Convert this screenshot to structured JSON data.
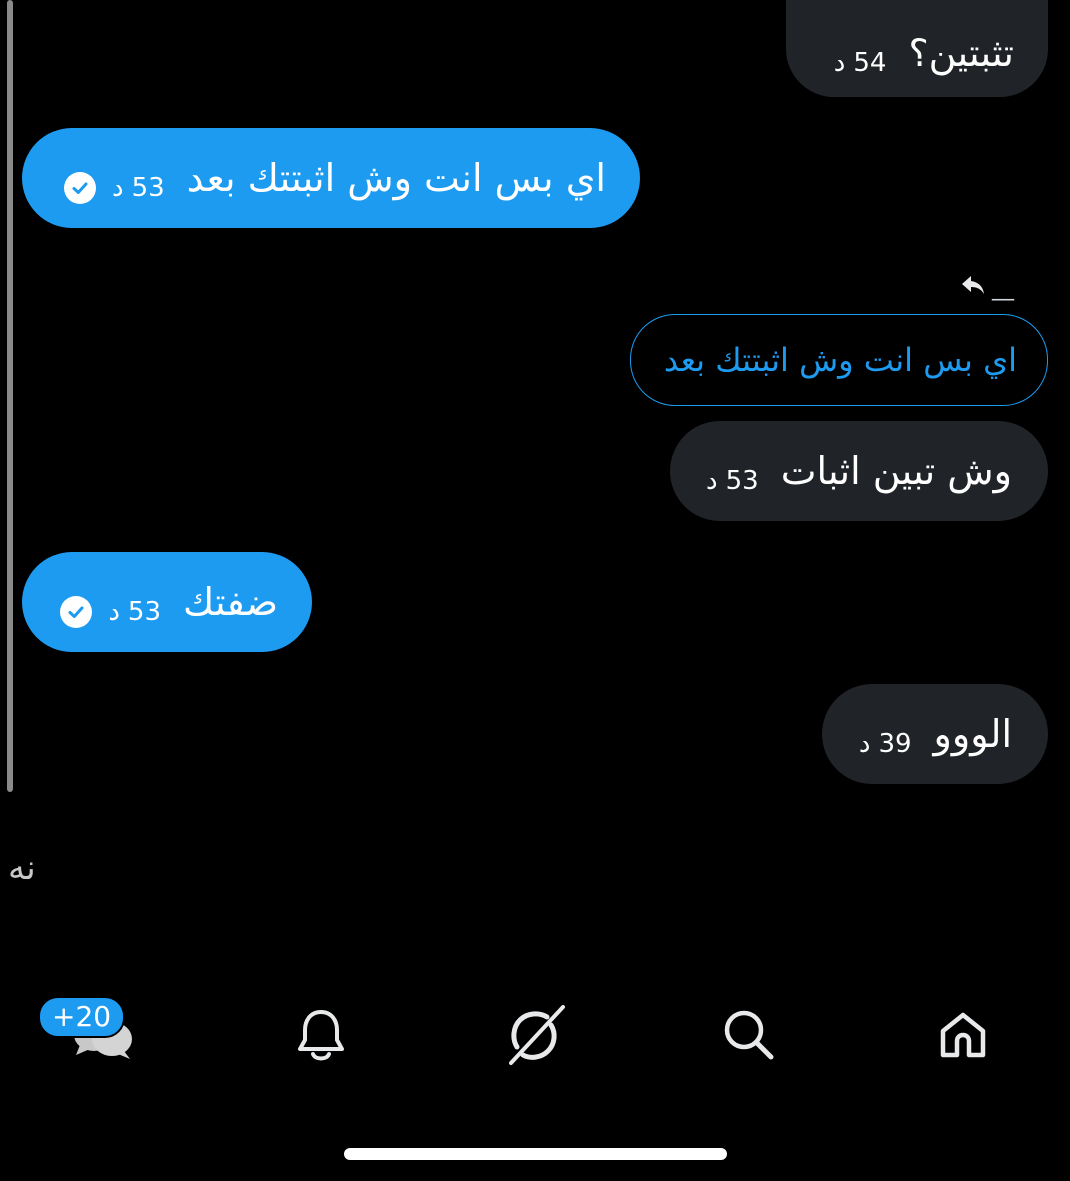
{
  "messages": [
    {
      "id": "m1",
      "text": "تثبتين؟",
      "time": "54",
      "unit": "د"
    },
    {
      "id": "m2",
      "text": "اي بس انت وش اثبتتك بعد",
      "time": "53",
      "unit": "د"
    },
    {
      "id": "m3",
      "reply_quote": "اي بس انت وش اثبتتك بعد",
      "reply_name": "__",
      "text": "وش تبين اثبات",
      "time": "53",
      "unit": "د"
    },
    {
      "id": "m4",
      "text": "ضفتك",
      "time": "53",
      "unit": "د"
    },
    {
      "id": "m5",
      "text": "الووو",
      "time": "39",
      "unit": "د"
    }
  ],
  "typing_text": "نه",
  "nav": {
    "messages_badge": "+20",
    "items": [
      "messages-icon",
      "notifications-bell-icon",
      "grok-icon",
      "search-icon",
      "home-icon"
    ]
  },
  "colors": {
    "accent": "#1d9bf0",
    "incoming_bubble": "#202327",
    "background": "#000000"
  }
}
